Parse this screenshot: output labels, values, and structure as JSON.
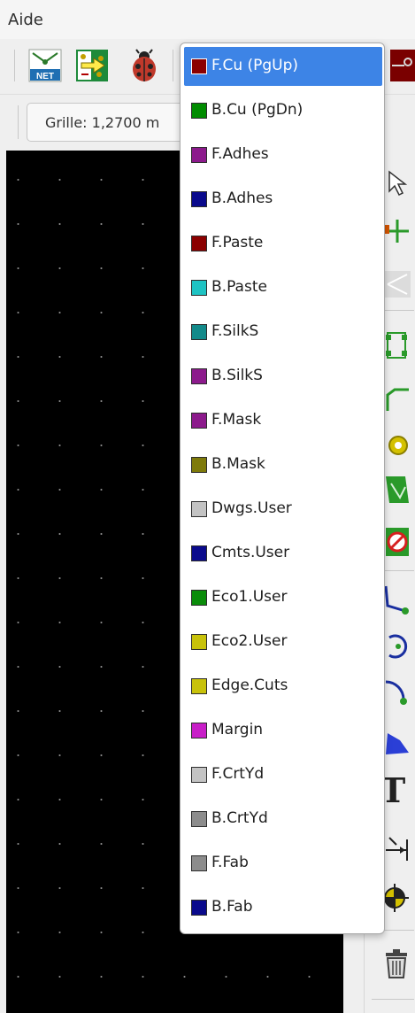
{
  "menubar": {
    "aide": "Aide"
  },
  "grid": {
    "label": "Grille: 1,2700 m"
  },
  "layers": [
    {
      "label": "F.Cu (PgUp)",
      "color": "#8b0000",
      "selected": true
    },
    {
      "label": "B.Cu (PgDn)",
      "color": "#008c00",
      "selected": false
    },
    {
      "label": "F.Adhes",
      "color": "#8c1a8c",
      "selected": false
    },
    {
      "label": "B.Adhes",
      "color": "#0a0a8c",
      "selected": false
    },
    {
      "label": "F.Paste",
      "color": "#8b0000",
      "selected": false
    },
    {
      "label": "B.Paste",
      "color": "#1ec3c3",
      "selected": false
    },
    {
      "label": "F.SilkS",
      "color": "#128a8a",
      "selected": false
    },
    {
      "label": "B.SilkS",
      "color": "#8c1a8c",
      "selected": false
    },
    {
      "label": "F.Mask",
      "color": "#8c1a8c",
      "selected": false
    },
    {
      "label": "B.Mask",
      "color": "#7e7a0a",
      "selected": false
    },
    {
      "label": "Dwgs.User",
      "color": "#c3c3c3",
      "selected": false
    },
    {
      "label": "Cmts.User",
      "color": "#0a0a8c",
      "selected": false
    },
    {
      "label": "Eco1.User",
      "color": "#0a8c0a",
      "selected": false
    },
    {
      "label": "Eco2.User",
      "color": "#c8c20a",
      "selected": false
    },
    {
      "label": "Edge.Cuts",
      "color": "#c8c20a",
      "selected": false
    },
    {
      "label": "Margin",
      "color": "#c81ec8",
      "selected": false
    },
    {
      "label": "F.CrtYd",
      "color": "#c3c3c3",
      "selected": false
    },
    {
      "label": "B.CrtYd",
      "color": "#8c8c8c",
      "selected": false
    },
    {
      "label": "F.Fab",
      "color": "#8c8c8c",
      "selected": false
    },
    {
      "label": "B.Fab",
      "color": "#0a0a8c",
      "selected": false
    }
  ],
  "icons": {
    "netlist": "netlist-icon",
    "update_pcb": "update-pcb-icon",
    "drc": "ladybug-icon"
  }
}
